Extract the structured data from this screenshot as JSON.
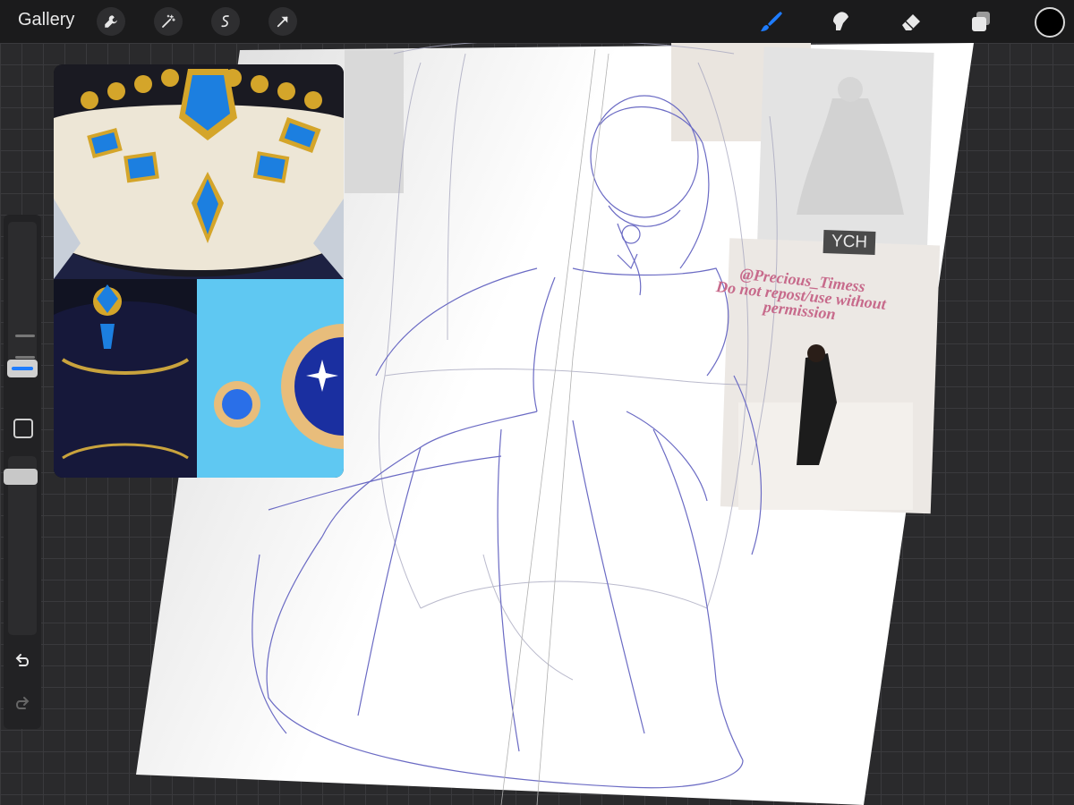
{
  "toolbar": {
    "gallery_label": "Gallery",
    "left_tools": [
      "wrench-icon",
      "magic-wand-icon",
      "selection-icon",
      "move-arrow-icon"
    ],
    "right_tools": [
      "brush-icon",
      "smudge-icon",
      "eraser-icon",
      "layers-icon"
    ],
    "active_tool": "brush-icon",
    "active_color": "#1e7cff",
    "current_color": "#000000"
  },
  "sidebar": {
    "brush_size_level": 0.55,
    "opacity_level": 0.25
  },
  "canvas": {
    "watermark_lines": [
      "@Precious_Timess",
      "Do not repost/use without",
      "permission"
    ],
    "ych_label": "YCH"
  }
}
